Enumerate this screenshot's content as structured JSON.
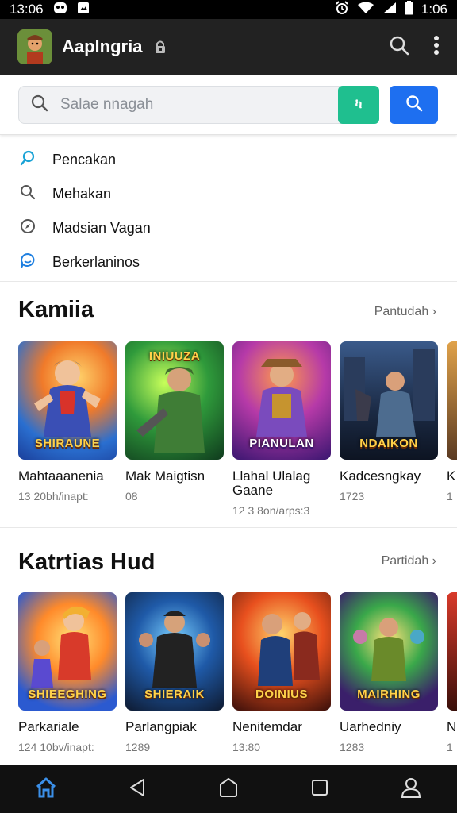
{
  "status_bar": {
    "time_left": "13:06",
    "time_right": "1:06",
    "icons": [
      "face-icon",
      "image-icon",
      "alarm-icon",
      "wifi-icon",
      "signal-icon",
      "battery-icon"
    ]
  },
  "app_bar": {
    "title": "Aaplngria",
    "icons": [
      "app-logo",
      "lock-icon",
      "search-icon",
      "more-vert-icon"
    ]
  },
  "search": {
    "placeholder": "Salae nnagah",
    "green_button_label": "ካ",
    "blue_button_icon": "search-icon"
  },
  "suggestions": [
    {
      "icon": "search-icon",
      "label": "Pencakan"
    },
    {
      "icon": "search-icon",
      "label": "Mehakan"
    },
    {
      "icon": "compass-icon",
      "label": "Madsian Vagan"
    },
    {
      "icon": "chat-icon",
      "label": "Berkerlaninos"
    }
  ],
  "sections": [
    {
      "title": "Kamiia",
      "more": "Pantudah",
      "cards": [
        {
          "thumb_text": "SHIRAUNE",
          "title": "Mahtaaanenia",
          "meta": "13 20bh/inapt:"
        },
        {
          "thumb_text": "INIUUZA",
          "title": "Mak Maigtisn",
          "meta": "08"
        },
        {
          "thumb_text": "PIANULAN",
          "title": "Llahal Ulalag Gaane",
          "meta": "12 3 8on/arps:3"
        },
        {
          "thumb_text": "NDAIKON",
          "title": "Kadcesngkay",
          "meta": "1723"
        },
        {
          "thumb_text": "",
          "title": "K",
          "meta": "1"
        }
      ]
    },
    {
      "title": "Katrtias Hud",
      "more": "Partidah",
      "cards": [
        {
          "thumb_text": "SHIEEGHING",
          "title": "Parkariale",
          "meta": "124 10bv/inapt:"
        },
        {
          "thumb_text": "SHIERAIK",
          "title": "Parlangpiak",
          "meta": "1289"
        },
        {
          "thumb_text": "DOINIUS",
          "title": "Nenitemdar",
          "meta": "13:80"
        },
        {
          "thumb_text": "MAIRHING",
          "title": "Uarhedniy",
          "meta": "1283"
        },
        {
          "thumb_text": "",
          "title": "N",
          "meta": "1"
        }
      ]
    }
  ],
  "nav": [
    "home-icon",
    "back-icon",
    "home-circle-icon",
    "recents-icon",
    "profile-icon"
  ],
  "colors": {
    "app_bar": "#222222",
    "accent_green": "#1fbf8f",
    "accent_blue": "#1e6ff0",
    "nav_active": "#3b8fe8"
  }
}
